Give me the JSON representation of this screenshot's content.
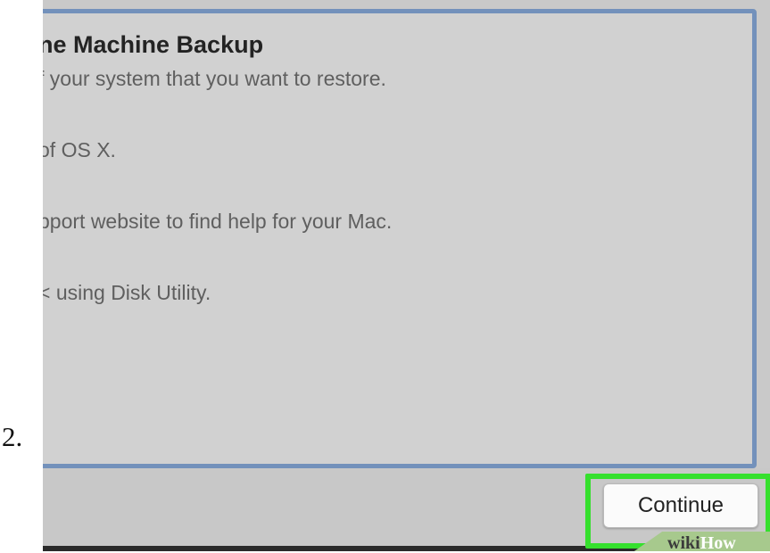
{
  "step": {
    "number": "2."
  },
  "panel": {
    "title": "ne Machine Backup",
    "lines": [
      "f your system that you want to restore.",
      "of OS X.",
      "pport website to find help for your Mac.",
      "< using Disk Utility."
    ]
  },
  "footer": {
    "continue_label": "Continue"
  },
  "watermark": {
    "wiki": "wiki",
    "how": "How"
  },
  "colors": {
    "highlight": "#35e02d",
    "frame": "#7391bb",
    "panel": "#d1d1d1"
  }
}
